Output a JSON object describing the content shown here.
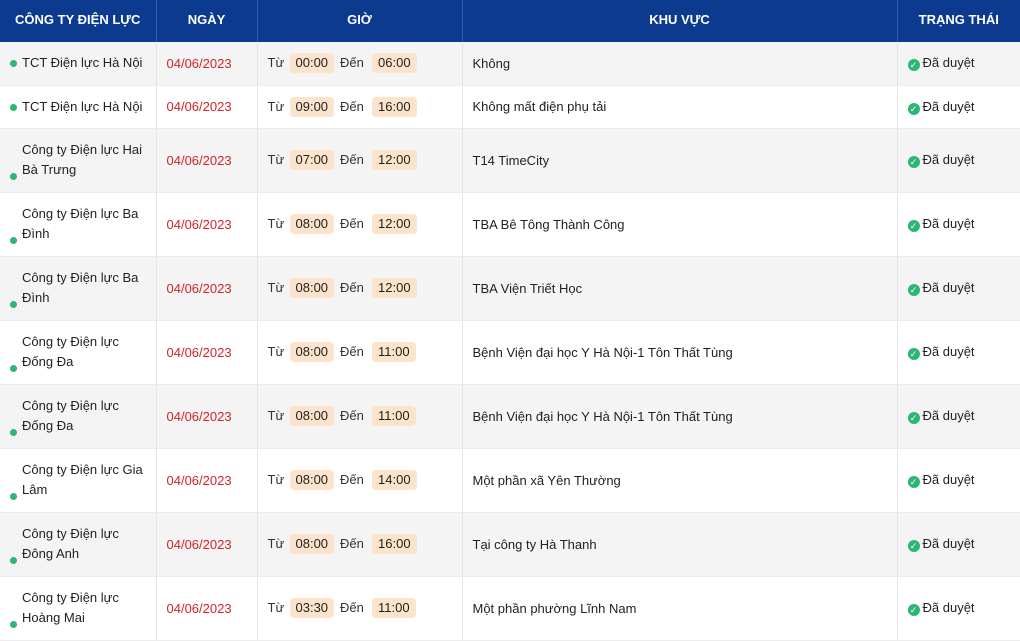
{
  "headers": {
    "company": "CÔNG TY ĐIỆN LỰC",
    "date": "NGÀY",
    "time": "GIỜ",
    "area": "KHU VỰC",
    "status": "TRẠNG THÁI"
  },
  "labels": {
    "from": "Từ",
    "to": "Đến"
  },
  "colors": {
    "header_bg": "#0b3a8f",
    "date_red": "#d2232a",
    "pill_bg": "#fbe3cc",
    "ok_green": "#2bb673"
  },
  "rows": [
    {
      "company": "TCT Điện lực Hà Nội",
      "date": "04/06/2023",
      "from": "00:00",
      "to": "06:00",
      "area": "Không",
      "status": "Đã duyệt"
    },
    {
      "company": "TCT Điện lực Hà Nội",
      "date": "04/06/2023",
      "from": "09:00",
      "to": "16:00",
      "area": "Không mất điện phụ tải",
      "status": "Đã duyệt"
    },
    {
      "company": "Công ty Điện lực Hai Bà Trưng",
      "date": "04/06/2023",
      "from": "07:00",
      "to": "12:00",
      "area": "T14 TimeCity",
      "status": "Đã duyệt"
    },
    {
      "company": "Công ty Điện lực Ba Đình",
      "date": "04/06/2023",
      "from": "08:00",
      "to": "12:00",
      "area": "TBA Bê Tông Thành Công",
      "status": "Đã duyệt"
    },
    {
      "company": "Công ty Điện lực Ba Đình",
      "date": "04/06/2023",
      "from": "08:00",
      "to": "12:00",
      "area": "TBA Viện Triết Học",
      "status": "Đã duyệt"
    },
    {
      "company": "Công ty Điện lực Đống Đa",
      "date": "04/06/2023",
      "from": "08:00",
      "to": "11:00",
      "area": "Bệnh Viện đại học Y Hà Nội-1 Tôn Thất Tùng",
      "status": "Đã duyệt"
    },
    {
      "company": "Công ty Điện lực Đống Đa",
      "date": "04/06/2023",
      "from": "08:00",
      "to": "11:00",
      "area": "Bệnh Viện đại học Y Hà Nội-1 Tôn Thất Tùng",
      "status": "Đã duyệt"
    },
    {
      "company": "Công ty Điện lực Gia Lâm",
      "date": "04/06/2023",
      "from": "08:00",
      "to": "14:00",
      "area": "Một phần xã Yên Thường",
      "status": "Đã duyệt"
    },
    {
      "company": "Công ty Điện lực Đông Anh",
      "date": "04/06/2023",
      "from": "08:00",
      "to": "16:00",
      "area": "Tại công ty Hà Thanh",
      "status": "Đã duyệt"
    },
    {
      "company": "Công ty Điện lực Hoàng Mai",
      "date": "04/06/2023",
      "from": "03:30",
      "to": "11:00",
      "area": "Một phần phường Lĩnh Nam",
      "status": "Đã duyệt"
    }
  ]
}
